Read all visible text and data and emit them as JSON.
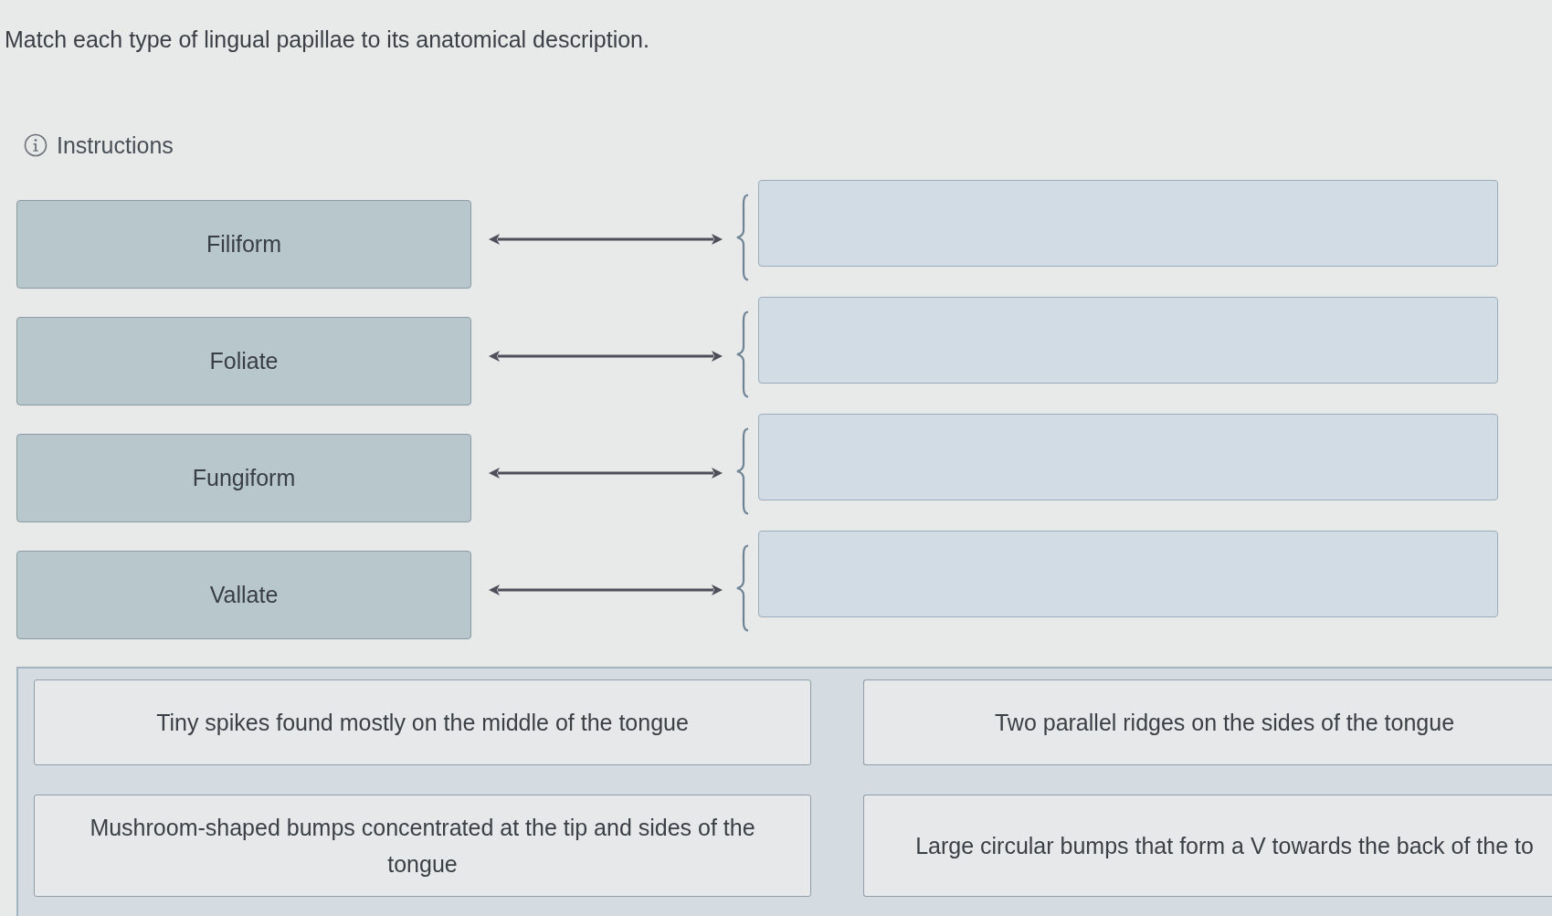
{
  "prompt": "Match each type of lingual papillae to its anatomical description.",
  "instructions": {
    "label": "Instructions"
  },
  "matches": [
    {
      "term": "Filiform"
    },
    {
      "term": "Foliate"
    },
    {
      "term": "Fungiform"
    },
    {
      "term": "Vallate"
    }
  ],
  "answer_bank": [
    "Tiny spikes found mostly on the middle of the tongue",
    "Two parallel ridges on the sides of the tongue",
    "Mushroom-shaped bumps concentrated at the tip and sides of the tongue",
    "Large circular bumps that form a V towards the back of the to"
  ]
}
